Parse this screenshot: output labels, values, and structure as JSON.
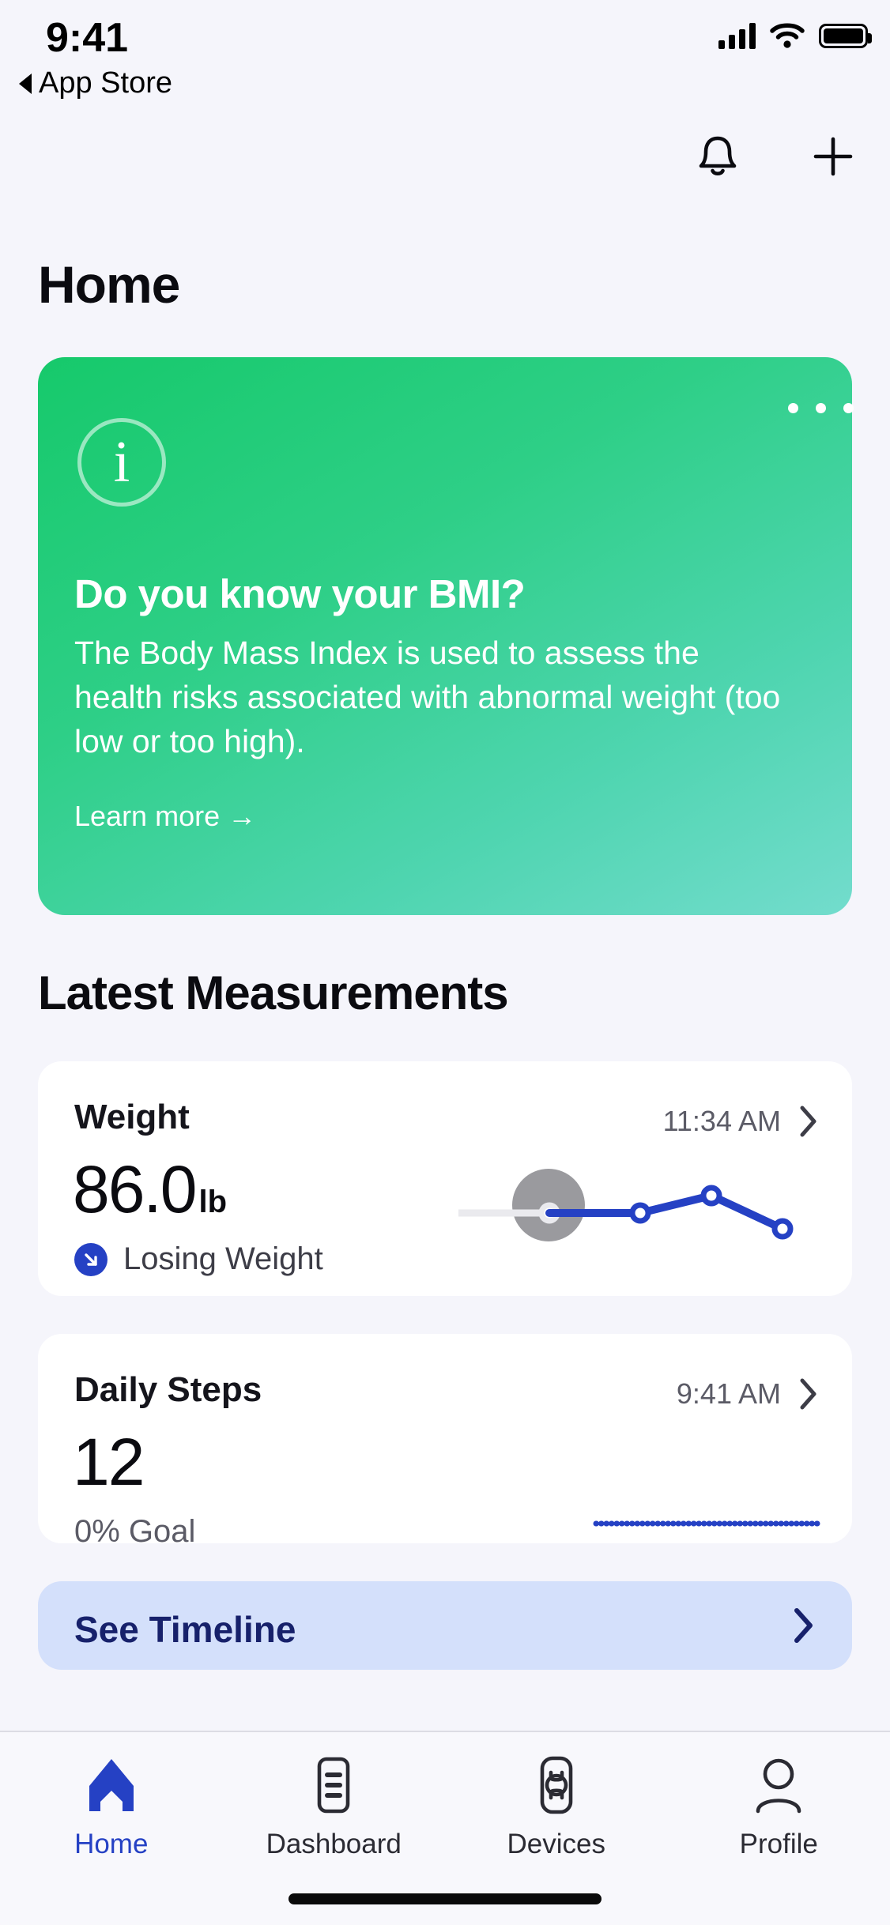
{
  "status_bar": {
    "time": "9:41",
    "back_label": "App Store",
    "icons": [
      "cellular-signal-icon",
      "wifi-icon",
      "battery-icon"
    ]
  },
  "header": {
    "notifications_icon": "bell-icon",
    "add_icon": "plus-icon"
  },
  "page": {
    "title": "Home"
  },
  "promo_card": {
    "icon": "info-icon",
    "overflow_icon": "more-horizontal-icon",
    "title": "Do you know your BMI?",
    "body": "The Body Mass Index is used to assess the health risks associated with abnormal weight (too low or too high).",
    "link_label": "Learn more →",
    "gradient_from": "#16c96b",
    "gradient_to": "#73dccd"
  },
  "measurements": {
    "section_title": "Latest Measurements",
    "cards": [
      {
        "label": "Weight",
        "time": "11:34 AM",
        "chevron_icon": "chevron-right-icon",
        "value": "86.0",
        "unit": "lb",
        "trend_icon": "arrow-down-right-icon",
        "trend_label": "Losing Weight",
        "trend_color": "#2541c4"
      },
      {
        "label": "Daily Steps",
        "time": "9:41 AM",
        "chevron_icon": "chevron-right-icon",
        "value": "12",
        "unit": "",
        "goal_label": "0% Goal",
        "progress_percent": 0,
        "progress_color": "#2541c4"
      }
    ]
  },
  "timeline_button": {
    "label": "See Timeline",
    "chevron_icon": "chevron-right-icon",
    "background": "#d4e0fb",
    "text_color": "#17216b"
  },
  "tab_bar": {
    "active": "Home",
    "accent": "#2541c4",
    "items": [
      {
        "label": "Home",
        "icon": "home-icon"
      },
      {
        "label": "Dashboard",
        "icon": "dashboard-list-icon"
      },
      {
        "label": "Devices",
        "icon": "smartwatch-icon"
      },
      {
        "label": "Profile",
        "icon": "person-icon"
      }
    ]
  },
  "chart_data": [
    {
      "type": "line",
      "title": "Weight sparkline",
      "x": [
        0,
        1,
        2,
        3,
        4,
        5
      ],
      "values": [
        null,
        null,
        60,
        60,
        78,
        40
      ],
      "line_color": "#2541c4",
      "muted_color": "#eaeaee",
      "grid": false,
      "legend": "none"
    },
    {
      "type": "bar",
      "title": "Daily Steps goal progress",
      "categories": [
        "0% Goal"
      ],
      "values": [
        0
      ],
      "ylim": [
        0,
        100
      ],
      "color": "#2541c4",
      "grid": false,
      "legend": "none"
    }
  ]
}
